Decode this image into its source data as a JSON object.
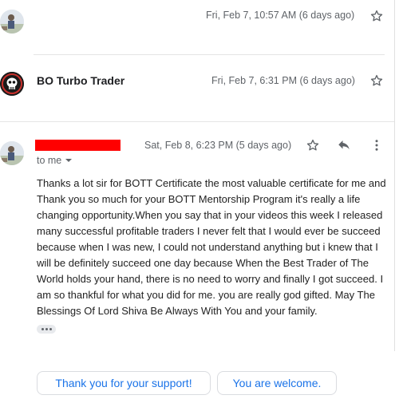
{
  "messages": [
    {
      "date": "Fri, Feb 7, 10:57 AM (6 days ago)",
      "avatar_icon": "person-avatar-photo"
    },
    {
      "sender": "BO Turbo Trader",
      "date": "Fri, Feb 7, 6:31 PM (6 days ago)",
      "avatar_icon": "skull-logo-avatar"
    },
    {
      "sender_redacted": true,
      "date": "Sat, Feb 8, 6:23 PM (5 days ago)",
      "recipient": "to me",
      "body": "Thanks a lot sir for BOTT Certificate the most valuable certificate for me and Thank you so much for your BOTT Mentorship Program it's really a life changing opportunity.When you say that in your videos this week I released many successful profitable traders I never felt that I would ever be succeed because when I was new, I could not understand anything but i knew that I will be definitely succeed one day because When the Best Trader of The World holds your hand, there is no need to worry and finally I got succeed. I am so thankful for what you did for me. you are really god gifted. May The Blessings Of Lord Shiva Be Always With You and your family."
    }
  ],
  "smart_replies": [
    "Thank you for your support!",
    "You are welcome."
  ],
  "icons": {
    "star": "star-outline-icon",
    "reply": "reply-arrow-icon",
    "more": "more-vert-icon",
    "expand": "chevron-down-icon",
    "trimmed": "ellipsis-icon"
  },
  "colors": {
    "link_blue": "#1a73e8",
    "secondary_text": "#5f6368",
    "redaction": "#ff0000"
  }
}
